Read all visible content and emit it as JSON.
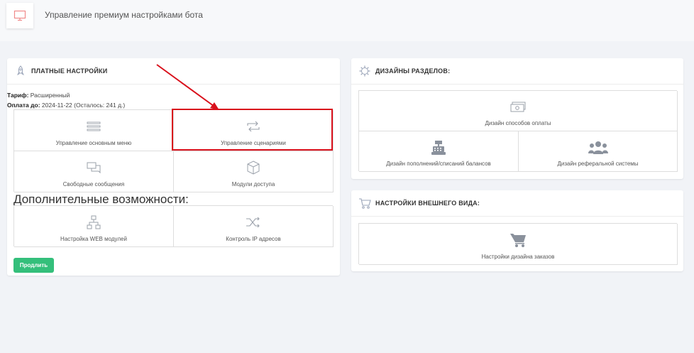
{
  "header": {
    "title": "Управление премиум настройками бота",
    "icon": "monitor-icon"
  },
  "paid": {
    "title": "ПЛАТНЫЕ НАСТРОЙКИ",
    "tariff_label": "Тариф:",
    "tariff_value": "Расширенный",
    "payment_label": "Оплата до:",
    "payment_value": "2024-11-22 (Осталось: 241 д.)",
    "tiles": [
      {
        "label": "Управление основным меню",
        "icon": "list-icon"
      },
      {
        "label": "Управление сценариями",
        "icon": "repeat-icon"
      },
      {
        "label": "Свободные сообщения",
        "icon": "chat-icon"
      },
      {
        "label": "Модули доступа",
        "icon": "cube-icon"
      }
    ],
    "extra_title": "Дополнительные возможности:",
    "extra_tiles": [
      {
        "label": "Настройка WEB модулей",
        "icon": "sitemap-icon"
      },
      {
        "label": "Контроль IP адресов",
        "icon": "shuffle-icon"
      }
    ],
    "extend_button": "Продлить"
  },
  "designs": {
    "title": "ДИЗАЙНЫ РАЗДЕЛОВ:",
    "tiles": [
      {
        "label": "Дизайн способов оплаты",
        "icon": "money-icon"
      },
      {
        "label": "Дизайн пополнений/списаний балансов",
        "icon": "cash-register-icon"
      },
      {
        "label": "Дизайн реферальной системы",
        "icon": "users-icon"
      }
    ]
  },
  "appearance": {
    "title": "НАСТРОЙКИ ВНЕШНЕГО ВИДА:",
    "tiles": [
      {
        "label": "Настройки дизайна заказов",
        "icon": "cart-icon"
      }
    ]
  },
  "colors": {
    "accent_green": "#34bf7b",
    "highlight_red": "#d9111c"
  }
}
